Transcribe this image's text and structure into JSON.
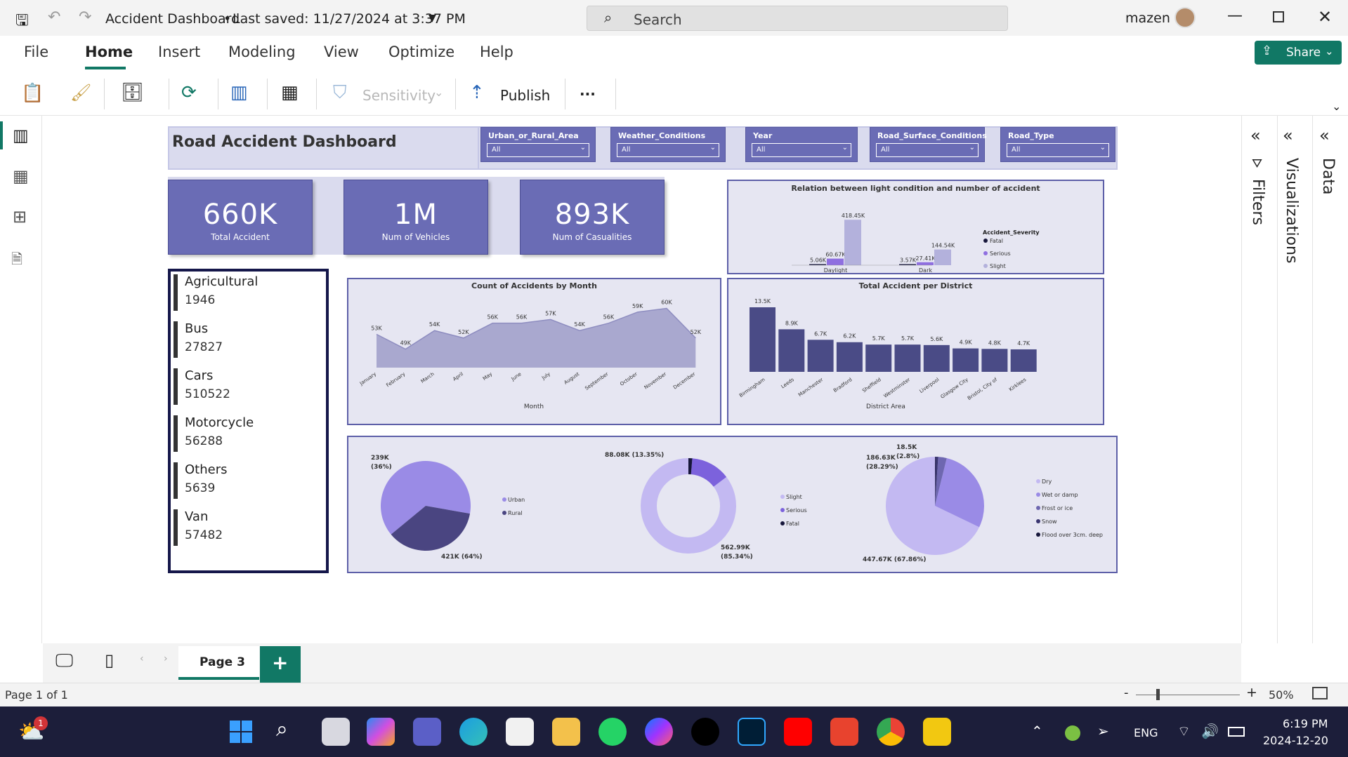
{
  "window": {
    "title": "Accident Dashboard",
    "saved": "Last saved: 11/27/2024 at 3:37 PM",
    "search_placeholder": "Search",
    "user": "mazen"
  },
  "menu": [
    "File",
    "Home",
    "Insert",
    "Modeling",
    "View",
    "Optimize",
    "Help"
  ],
  "share_label": "Share",
  "toolbar": {
    "sensitivity": "Sensitivity",
    "publish": "Publish",
    "more": "···"
  },
  "panes": {
    "filters": "Filters",
    "visualizations": "Visualizations",
    "data": "Data"
  },
  "dashboard": {
    "title": "Road Accident Dashboard",
    "slicers": [
      {
        "label": "Urban_or_Rural_Area",
        "value": "All"
      },
      {
        "label": "Weather_Conditions",
        "value": "All"
      },
      {
        "label": "Year",
        "value": "All"
      },
      {
        "label": "Road_Surface_Conditions",
        "value": "All"
      },
      {
        "label": "Road_Type",
        "value": "All"
      }
    ],
    "kpis": [
      {
        "value": "660K",
        "label": "Total Accident"
      },
      {
        "value": "1M",
        "label": "Num of Vehicles"
      },
      {
        "value": "893K",
        "label": "Num of Casualities"
      }
    ],
    "vehicle_types": [
      {
        "name": "Agricultural",
        "count": "1946"
      },
      {
        "name": "Bus",
        "count": "27827"
      },
      {
        "name": "Cars",
        "count": "510522"
      },
      {
        "name": "Motorcycle",
        "count": "56288"
      },
      {
        "name": "Others",
        "count": "5639"
      },
      {
        "name": "Van",
        "count": "57482"
      }
    ]
  },
  "chart_data": [
    {
      "type": "bar",
      "title": "Relation between light condition and number of accident",
      "categories": [
        "Daylight",
        "Dark"
      ],
      "legend_title": "Accident_Severity",
      "series": [
        {
          "name": "Fatal",
          "values": [
            5.06,
            3.57
          ],
          "labels": [
            "5.06K",
            "3.57K"
          ],
          "color": "#16163a"
        },
        {
          "name": "Serious",
          "values": [
            60.67,
            27.41
          ],
          "labels": [
            "60.67K",
            "27.41K"
          ],
          "color": "#8f6fe0"
        },
        {
          "name": "Slight",
          "values": [
            418.45,
            144.54
          ],
          "labels": [
            "418.45K",
            "144.54K"
          ],
          "color": "#b3b1dc"
        }
      ]
    },
    {
      "type": "area",
      "title": "Count of Accidents by Month",
      "xlabel": "Month",
      "categories": [
        "January",
        "February",
        "March",
        "April",
        "May",
        "June",
        "July",
        "August",
        "September",
        "October",
        "November",
        "December"
      ],
      "values": [
        53,
        49,
        54,
        52,
        56,
        56,
        57,
        54,
        56,
        59,
        60,
        52
      ],
      "labels": [
        "53K",
        "49K",
        "54K",
        "52K",
        "56K",
        "56K",
        "57K",
        "54K",
        "56K",
        "59K",
        "60K",
        "52K"
      ]
    },
    {
      "type": "bar",
      "title": "Total Accident per District",
      "xlabel": "District Area",
      "categories": [
        "Birmingham",
        "Leeds",
        "Manchester",
        "Bradford",
        "Sheffield",
        "Westminster",
        "Liverpool",
        "Glasgow City",
        "Bristol, City of",
        "Kirklees"
      ],
      "values": [
        13.5,
        8.9,
        6.7,
        6.2,
        5.7,
        5.7,
        5.6,
        4.9,
        4.8,
        4.7
      ],
      "labels": [
        "13.5K",
        "8.9K",
        "6.7K",
        "6.2K",
        "5.7K",
        "5.7K",
        "5.6K",
        "4.9K",
        "4.8K",
        "4.7K"
      ]
    },
    {
      "type": "pie",
      "categories": [
        "Urban",
        "Rural"
      ],
      "values": [
        421,
        239
      ],
      "labels": [
        "421K (64%)",
        "239K\n(36%)"
      ],
      "colors": [
        "#9a8be6",
        "#4a4581"
      ]
    },
    {
      "type": "pie",
      "donut": true,
      "categories": [
        "Slight",
        "Serious",
        "Fatal"
      ],
      "values": [
        562.99,
        88.08,
        8.6
      ],
      "labels": [
        "562.99K\n(85.34%)",
        "88.08K (13.35%)",
        ""
      ],
      "colors": [
        "#c3b9f2",
        "#7c62dc",
        "#16163a"
      ]
    },
    {
      "type": "pie",
      "categories": [
        "Dry",
        "Wet or damp",
        "Frost or ice",
        "Snow",
        "Flood over 3cm. deep"
      ],
      "values": [
        447.67,
        186.63,
        18.5,
        5.9,
        1.0
      ],
      "labels": [
        "447.67K (67.86%)",
        "186.63K\n(28.29%)",
        "18.5K\n(2.8%)",
        "",
        ""
      ],
      "colors": [
        "#c3b9f2",
        "#9a8be6",
        "#6e67b0",
        "#3a3570",
        "#16163a"
      ]
    }
  ],
  "page_tab": "Page 3",
  "status": {
    "page": "Page 1 of 1",
    "zoom": "50%"
  },
  "taskbar": {
    "lang": "ENG",
    "time": "6:19 PM",
    "date": "2024-12-20",
    "badge": "1"
  }
}
